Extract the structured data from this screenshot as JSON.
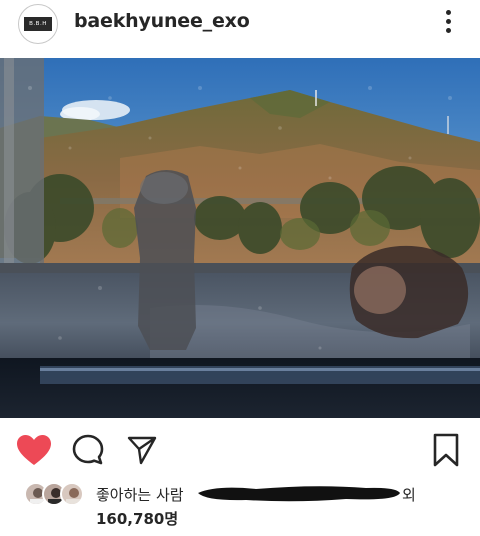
{
  "post": {
    "username": "baekhyunee_exo",
    "avatar_text": "B.B.H",
    "more_icon": "more-vertical-icon"
  },
  "actions": {
    "like_icon": "heart-filled-icon",
    "comment_icon": "comment-icon",
    "share_icon": "send-icon",
    "save_icon": "bookmark-icon",
    "like_color": "#ed4956"
  },
  "likes": {
    "liked_by_label": "좋아하는 사람",
    "liked_by_suffix": "외",
    "count": "160,780명"
  }
}
